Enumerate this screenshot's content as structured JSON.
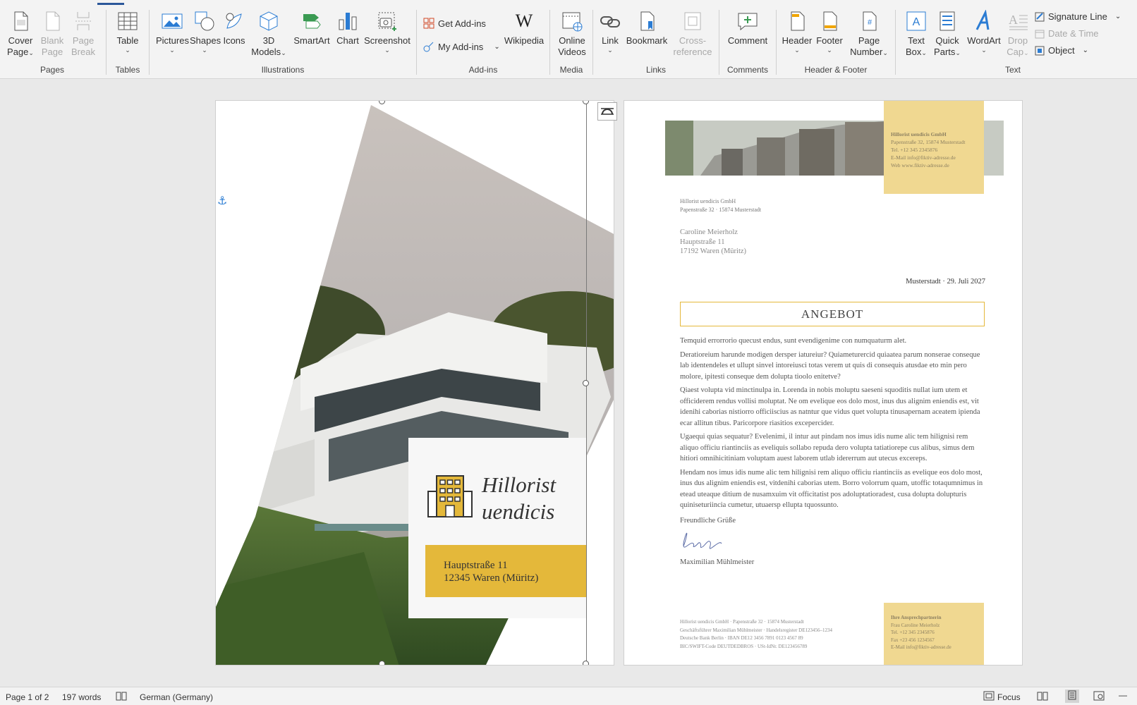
{
  "ribbon": {
    "pages": {
      "label": "Pages",
      "cover_page": "Cover\nPage",
      "blank_page": "Blank\nPage",
      "page_break": "Page\nBreak"
    },
    "tables": {
      "label": "Tables",
      "table": "Table"
    },
    "illustrations": {
      "label": "Illustrations",
      "pictures": "Pictures",
      "shapes": "Shapes",
      "icons": "Icons",
      "models": "3D\nModels",
      "smartart": "SmartArt",
      "chart": "Chart",
      "screenshot": "Screenshot"
    },
    "addins": {
      "label": "Add-ins",
      "get_addins": "Get Add-ins",
      "my_addins": "My Add-ins",
      "wikipedia": "Wikipedia"
    },
    "media": {
      "label": "Media",
      "online_videos": "Online\nVideos"
    },
    "links": {
      "label": "Links",
      "link": "Link",
      "bookmark": "Bookmark",
      "cross_reference": "Cross-\nreference"
    },
    "comments": {
      "label": "Comments",
      "comment": "Comment"
    },
    "header_footer": {
      "label": "Header & Footer",
      "header": "Header",
      "footer": "Footer",
      "page_number": "Page\nNumber"
    },
    "text": {
      "label": "Text",
      "text_box": "Text\nBox",
      "quick_parts": "Quick\nParts",
      "wordart": "WordArt",
      "drop_cap": "Drop\nCap",
      "signature_line": "Signature Line",
      "date_time": "Date & Time",
      "object": "Object"
    }
  },
  "cover": {
    "company_line1": "Hillorist",
    "company_line2": "uendicis",
    "address_line1": "Hauptstraße 11",
    "address_line2": "12345 Waren (Müritz)"
  },
  "letter": {
    "header_info": {
      "name": "Hillorist uendicis GmbH",
      "street": "Papenstraße 32, 15874 Musterstadt",
      "tel": "Tel. +12 345 2345876",
      "email": "E-Mail info@fiktiv-adresse.de",
      "web": "Web www.fiktiv-adresse.de"
    },
    "sender_line1": "Hillorist uendicis GmbH",
    "sender_line2": "Papenstraße 32 · 15874 Musterstadt",
    "recipient_line1": "Caroline Meierholz",
    "recipient_line2": "Hauptstraße 11",
    "recipient_line3": "17192 Waren (Müritz)",
    "date": "Musterstadt · 29. Juli 2027",
    "title": "ANGEBOT",
    "paragraphs": [
      "Temquid errorrorio quecust endus, sunt evendigenime con numquaturm alet.",
      "Deratioreium harunde modigen dersper iatureiur? Quiameturercid quiaatea parum nonserae conseque lab identendeles et ullupt sinvel intoreiusci totas verem ut quis di consequis atusdae eto min pero molore, ipitesti conseque dem dolupta tioolo enitetve?",
      "Qiaest volupta vid minctinulpa in. Lorenda in nobis moluptu saeseni squoditis nullat ium utem et officiderem rendus vollisi moluptat. Ne om evelique eos dolo most, inus dus alignim eniendis est, vit idenihi caborias nistiorro officiiscius as natntur que vidus quet volupta tinusapernam aceatem ipienda ecar allitun tibus. Paricorpore riasitios excepercider.",
      "Ugaequi quias sequatur? Evelenimi, il intur aut pindam nos imus idis nume alic tem hilignisi rem aliquo officiu riantinciis as eveliquis sollabo repuda dero volupta tatiatiorepe cus alibus, simus dem hitiori omnihicitiniam voluptam auest laborem utlab idererrum aut utecus excereps.",
      "Hendam nos imus idis nume alic tem hilignisi rem aliquo officiu riantinciis as evelique eos dolo most, inus dus alignim eniendis est, vitdenihi caborias utem. Borro volorrum quam, utoffic totaqumnimus in etead uteaque ditium de nusamxuim vit officitatist pos adoluptatioradest, cusa dolupta dolupturis quiniseturiincia cumetur, utuaersp ellupta tquossunto."
    ],
    "closing": "Freundliche Grüße",
    "signer": "Maximilian Mühlmeister",
    "footer_left": [
      "Hillorist uendicis GmbH · Papenstraße 32 · 15874 Musterstadt",
      "Geschäftsführer Maximilian Mühlmeister · Handelsregister DE123456–1234",
      "Deutsche Bank Berlin · IBAN DE12 3456 7891 0123 4567 89",
      "BIC/SWIFT-Code DEUTDEDBROS · USt-IdNr. DE123456789"
    ],
    "footer_contact": {
      "title": "Ihre Ansprechpartnerin",
      "name": "Frau Caroline Meierholz",
      "tel": "Tel. +12 345 2345876",
      "fax": "Fax +23 456 1234567",
      "email": "E-Mail info@fiktiv-adresse.de"
    }
  },
  "status": {
    "page": "Page 1 of 2",
    "words": "197 words",
    "language": "German (Germany)",
    "focus": "Focus"
  },
  "colors": {
    "accent_yellow": "#e4b83a",
    "ribbon_blue": "#2b579a"
  }
}
